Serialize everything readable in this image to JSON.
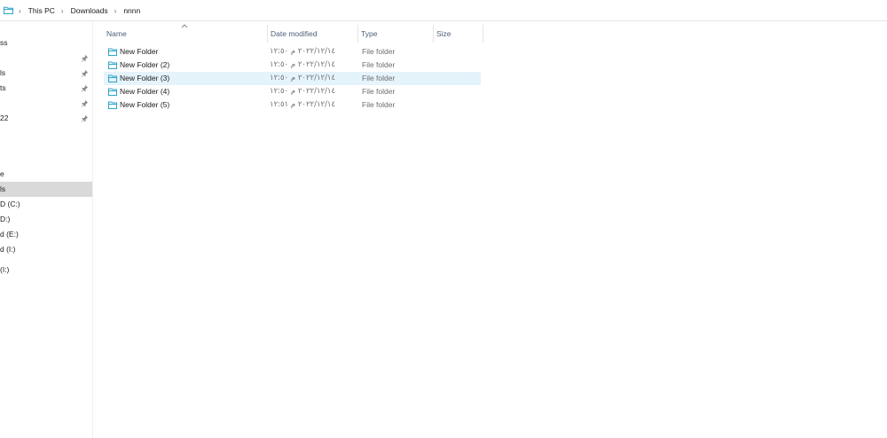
{
  "breadcrumb": {
    "items": [
      "This PC",
      "Downloads",
      "nnnn"
    ],
    "separator": "›"
  },
  "nav": {
    "items": [
      {
        "label": "ss",
        "pinned": false
      },
      {
        "label": "",
        "pinned": true
      },
      {
        "label": "ls",
        "pinned": true
      },
      {
        "label": "ts",
        "pinned": true
      },
      {
        "label": "",
        "pinned": true
      },
      {
        "label": "22",
        "pinned": true
      },
      {
        "label": "e",
        "pinned": false
      },
      {
        "label": "ls",
        "pinned": false,
        "selected": true
      },
      {
        "label": "D (C:)",
        "pinned": false
      },
      {
        "label": "D:)",
        "pinned": false
      },
      {
        "label": "d (E:)",
        "pinned": false
      },
      {
        "label": "d (I:)",
        "pinned": false
      },
      {
        "label": "(I:)",
        "pinned": false
      }
    ]
  },
  "columns": {
    "name": "Name",
    "date": "Date modified",
    "type": "Type",
    "size": "Size"
  },
  "files": [
    {
      "name": "New Folder",
      "date": "٢٠٢٢/١٢/١٤ م ١٢:٥٠",
      "type": "File folder",
      "size": ""
    },
    {
      "name": "New Folder (2)",
      "date": "٢٠٢٢/١٢/١٤ م ١٢:٥٠",
      "type": "File folder",
      "size": ""
    },
    {
      "name": "New Folder (3)",
      "date": "٢٠٢٢/١٢/١٤ م ١٢:٥٠",
      "type": "File folder",
      "size": "",
      "selected": true
    },
    {
      "name": "New Folder (4)",
      "date": "٢٠٢٢/١٢/١٤ م ١٢:٥٠",
      "type": "File folder",
      "size": ""
    },
    {
      "name": "New Folder (5)",
      "date": "٢٠٢٢/١٢/١٤ م ١٢:٥١",
      "type": "File folder",
      "size": ""
    }
  ],
  "colors": {
    "accent_folder": "#2ea4c7",
    "selected_row": "#e5f3fb",
    "selected_nav": "#d9d9d9",
    "header_text": "#4c607a"
  },
  "icons": {
    "address_bar": "folder-icon",
    "sort": "sort-ascending-caret-icon",
    "pin": "pin-icon",
    "file_item": "folder-icon"
  }
}
